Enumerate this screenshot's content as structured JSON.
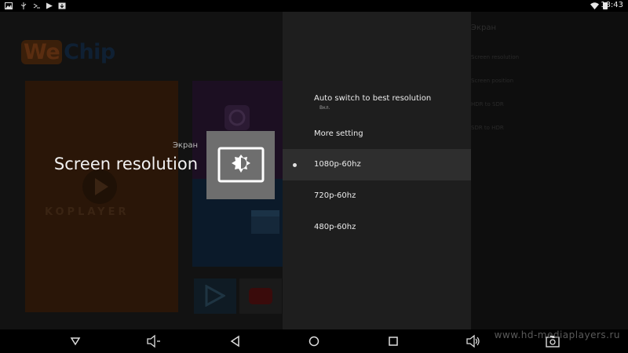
{
  "status_bar": {
    "time": "18:43",
    "left_icons": [
      "image-icon",
      "usb-icon",
      "usb-debug-icon",
      "play-store-icon",
      "download-icon"
    ],
    "right_icons": [
      "wifi-icon",
      "battery-icon"
    ]
  },
  "launcher": {
    "logo_we": "We",
    "logo_chip": "Chip",
    "koplayer_label": "KOPLAYER"
  },
  "dialog": {
    "section_caption": "Экран",
    "title": "Screen resolution",
    "icon": "brightness-icon"
  },
  "menu": {
    "auto_switch": {
      "label": "Auto switch to best resolution",
      "sub": "Вкл."
    },
    "more_setting": "More setting",
    "options": [
      {
        "label": "1080p-60hz",
        "selected": true
      },
      {
        "label": "720p-60hz",
        "selected": false
      },
      {
        "label": "480p-60hz",
        "selected": false
      }
    ]
  },
  "background_list": {
    "title": "Экран",
    "items": [
      "Screen resolution",
      "Screen position",
      "HDR to SDR",
      "SDR to HDR"
    ]
  },
  "nav_bar": {
    "buttons": [
      "hide-keyboard",
      "volume-down",
      "back",
      "home",
      "recents",
      "volume-up",
      "screenshot"
    ],
    "watermark": "www.hd-mediaplayers.ru"
  },
  "colors": {
    "panel": "#1e1e1e",
    "selected_row": "#2e2e2e",
    "icon_box": "#6e6e6e"
  }
}
